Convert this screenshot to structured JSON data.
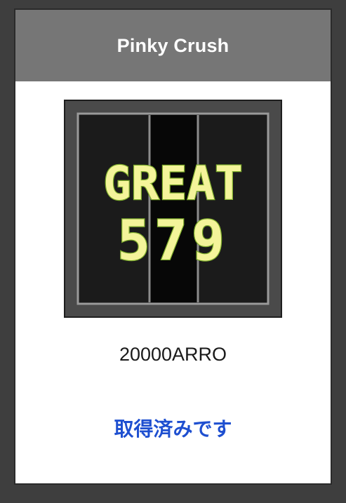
{
  "dialog": {
    "title": "Pinky Crush",
    "item_name": "20000ARRO",
    "status_label": "取得済みです"
  },
  "thumbnail": {
    "line1": "GREAT",
    "line2": "579",
    "text_color": "#f4f49a",
    "text_outline": "#7fae2c"
  },
  "colors": {
    "backdrop": "#3e3e3e",
    "header": "#767676",
    "status": "#1e4fd0"
  }
}
